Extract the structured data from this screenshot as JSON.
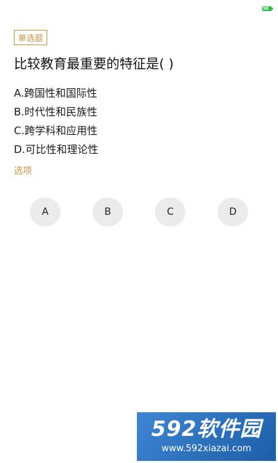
{
  "status_bar": {
    "battery_text": "58",
    "battery_color": "#2fbf4a"
  },
  "question": {
    "type_tag": "单选题",
    "text": "比较教育最重要的特征是( )",
    "options": [
      "A.跨国性和国际性",
      "B.时代性和民族性",
      "C.跨学科和应用性",
      "D.可比性和理论性"
    ]
  },
  "answer_section": {
    "label": "选项",
    "choices": [
      "A",
      "B",
      "C",
      "D"
    ]
  },
  "watermark": {
    "brand": "592软件园",
    "url": "www.592xiazai.com"
  },
  "colors": {
    "accent": "#c8953f",
    "button_bg": "#ebebeb",
    "watermark_bg": "#2b73c2"
  }
}
